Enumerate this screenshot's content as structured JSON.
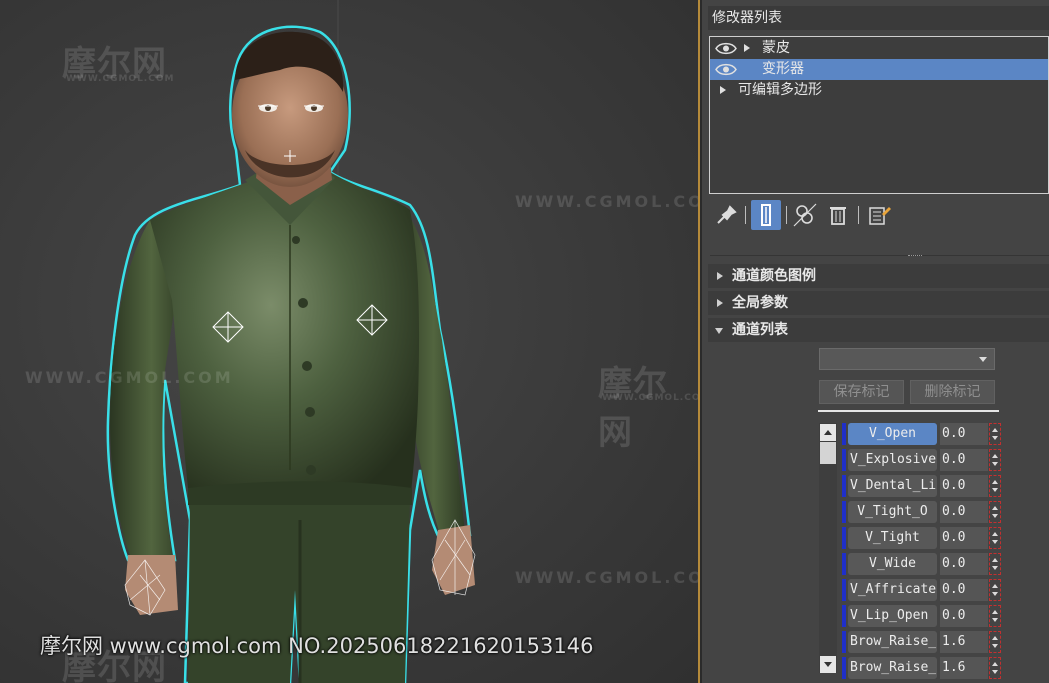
{
  "watermarks": {
    "brand": "摩尔网",
    "domain_small": "WWW.CGMOL.COM",
    "domain_wide": "WWW.CGMOL.COM",
    "footer": "摩尔网 www.cgmol.com NO.20250618221620153146"
  },
  "modifier_panel": {
    "title": "修改器列表",
    "stack": [
      {
        "label": "蒙皮",
        "eye": true,
        "expandable": true,
        "selected": false
      },
      {
        "label": "变形器",
        "eye": true,
        "expandable": false,
        "selected": true
      },
      {
        "label": "可编辑多边形",
        "eye": false,
        "expandable": true,
        "selected": false
      }
    ],
    "toolbar_icons": [
      "pin-stack-icon",
      "show-end-result-icon",
      "make-unique-icon",
      "remove-modifier-icon",
      "configure-sets-icon"
    ]
  },
  "rollouts": [
    {
      "label": "通道颜色图例",
      "expanded": false
    },
    {
      "label": "全局参数",
      "expanded": false
    },
    {
      "label": "通道列表",
      "expanded": true
    }
  ],
  "channel_list": {
    "dropdown_value": "",
    "save_marker": "保存标记",
    "delete_marker": "删除标记",
    "channels": [
      {
        "name": "V_Open",
        "value": "0.0",
        "active": true,
        "left": false
      },
      {
        "name": "V_Explosive",
        "value": "0.0",
        "active": false,
        "left": true
      },
      {
        "name": "V_Dental_Li",
        "value": "0.0",
        "active": false,
        "left": true
      },
      {
        "name": "V_Tight_O",
        "value": "0.0",
        "active": false,
        "left": false
      },
      {
        "name": "V_Tight",
        "value": "0.0",
        "active": false,
        "left": false
      },
      {
        "name": "V_Wide",
        "value": "0.0",
        "active": false,
        "left": false
      },
      {
        "name": "V_Affricate",
        "value": "0.0",
        "active": false,
        "left": true
      },
      {
        "name": "V_Lip_Open",
        "value": "0.0",
        "active": false,
        "left": true
      },
      {
        "name": "Brow_Raise_",
        "value": "1.6",
        "active": false,
        "left": true
      },
      {
        "name": "Brow_Raise_",
        "value": "1.6",
        "active": false,
        "left": true
      }
    ]
  },
  "colors": {
    "selection_blue": "#5b86c5",
    "channel_marker": "#1f2fc9",
    "viewport_border": "#b58a3a",
    "selection_outline": "#39e0e8",
    "shirt_green": "#3f5232"
  }
}
